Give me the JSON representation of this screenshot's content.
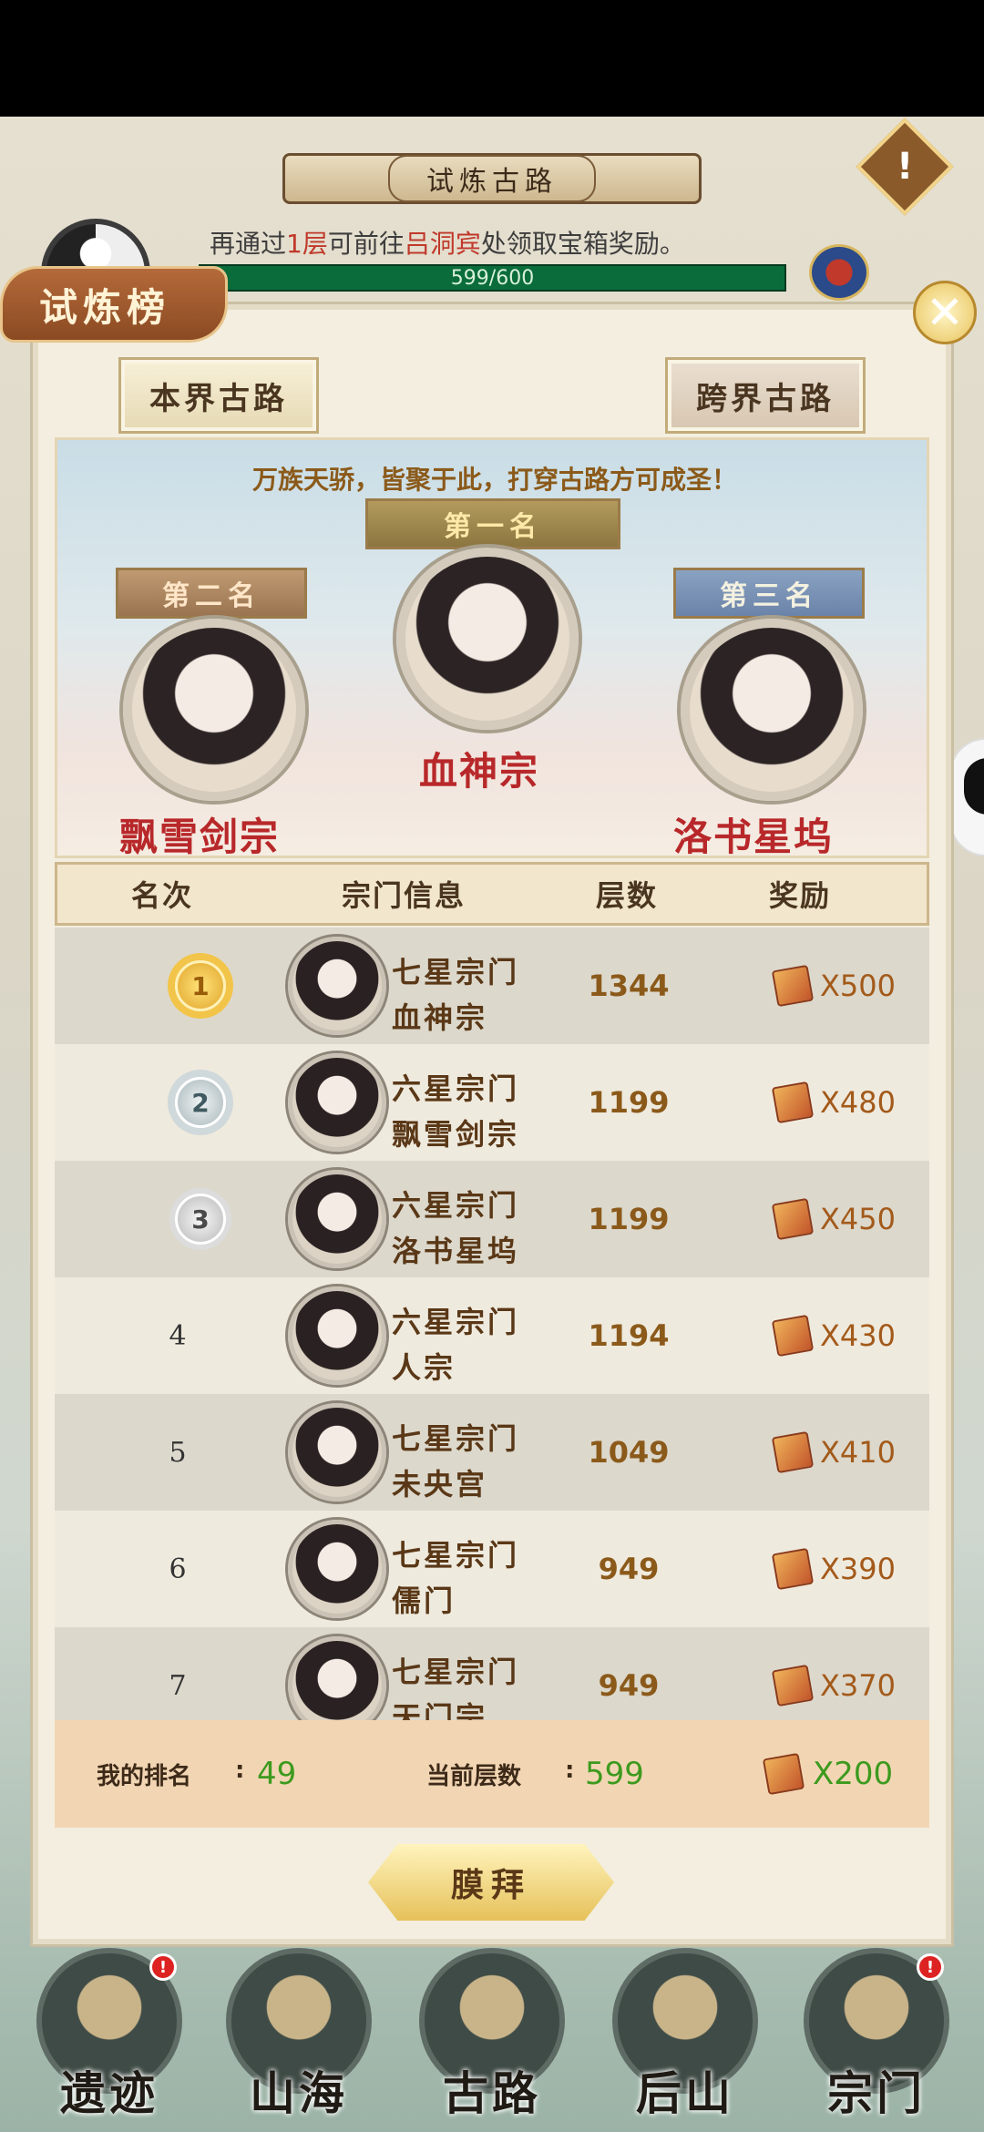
{
  "scene": {
    "road_title": "试炼古路",
    "warning_glyph": "!",
    "tip": {
      "pre": "再通过",
      "floors": "1层",
      "mid": "可前往",
      "npc": "吕洞宾",
      "post": "处领取宝箱奖励。"
    },
    "progress": {
      "text": "599/600",
      "current": 599,
      "max": 600
    }
  },
  "dialog": {
    "title": "试炼榜",
    "close_glyph": "✕",
    "tabs": [
      {
        "label": "本界古路",
        "active": true
      },
      {
        "label": "跨界古路",
        "active": false
      }
    ],
    "slogan": "万族天骄，皆聚于此，打穿古路方可成圣！",
    "podium": {
      "first": {
        "banner": "第一名",
        "sect": "血神宗"
      },
      "second": {
        "banner": "第二名",
        "sect": "飘雪剑宗"
      },
      "third": {
        "banner": "第三名",
        "sect": "洛书星坞"
      }
    },
    "table": {
      "headers": {
        "rank": "名次",
        "sect": "宗门信息",
        "floor": "层数",
        "reward": "奖励"
      },
      "rows": [
        {
          "rank": "1",
          "tier": "七星宗门",
          "sect": "血神宗",
          "floor": "1344",
          "reward": "X500"
        },
        {
          "rank": "2",
          "tier": "六星宗门",
          "sect": "飘雪剑宗",
          "floor": "1199",
          "reward": "X480"
        },
        {
          "rank": "3",
          "tier": "六星宗门",
          "sect": "洛书星坞",
          "floor": "1199",
          "reward": "X450"
        },
        {
          "rank": "4",
          "tier": "六星宗门",
          "sect": "人宗",
          "floor": "1194",
          "reward": "X430"
        },
        {
          "rank": "5",
          "tier": "七星宗门",
          "sect": "未央宫",
          "floor": "1049",
          "reward": "X410"
        },
        {
          "rank": "6",
          "tier": "七星宗门",
          "sect": "儒门",
          "floor": "949",
          "reward": "X390"
        },
        {
          "rank": "7",
          "tier": "七星宗门",
          "sect": "天门宗",
          "floor": "949",
          "reward": "X370"
        }
      ]
    },
    "my_rank": {
      "rank_label": "我的排名",
      "rank_value": "49",
      "floor_label": "当前层数",
      "floor_value": "599",
      "reward_value": "X200"
    },
    "worship_label": "膜拜"
  },
  "bottom_nav": {
    "items": [
      {
        "label": "遗迹",
        "badge": "!"
      },
      {
        "label": "山海",
        "badge": ""
      },
      {
        "label": "古路",
        "badge": ""
      },
      {
        "label": "后山",
        "badge": ""
      },
      {
        "label": "宗门",
        "badge": "!"
      }
    ]
  },
  "colors": {
    "highlight_red": "#c0392b",
    "progress_green": "#0a6c3b",
    "my_rank_value_green": "#3d9a1e",
    "floor_brown": "#8b5a1a"
  }
}
